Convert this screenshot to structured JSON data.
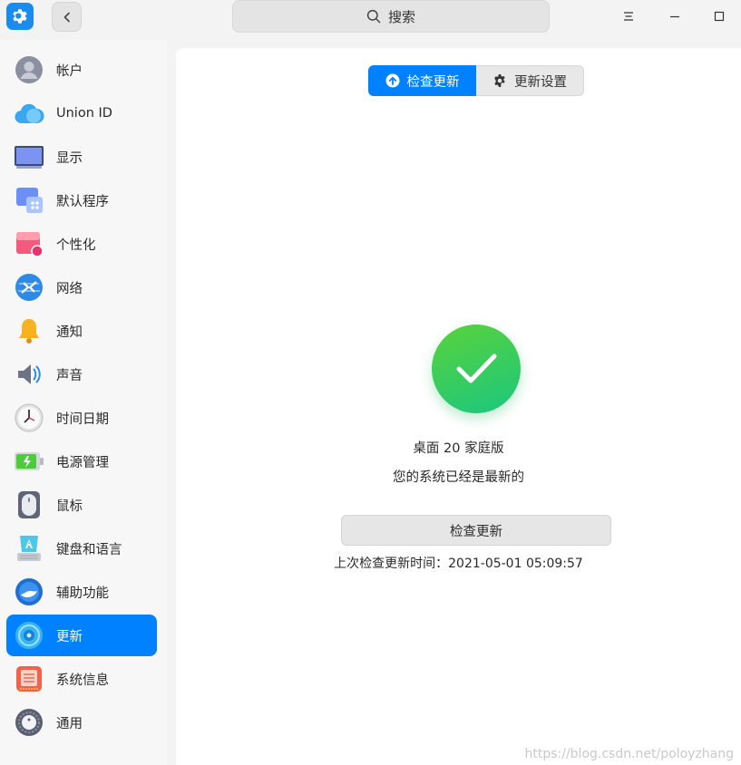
{
  "titlebar": {
    "search_label": "搜索"
  },
  "sidebar": {
    "items": [
      {
        "label": "帐户",
        "icon": "account-icon"
      },
      {
        "label": "Union ID",
        "icon": "cloud-icon"
      },
      {
        "label": "显示",
        "icon": "display-icon"
      },
      {
        "label": "默认程序",
        "icon": "default-apps-icon"
      },
      {
        "label": "个性化",
        "icon": "personalization-icon"
      },
      {
        "label": "网络",
        "icon": "network-icon"
      },
      {
        "label": "通知",
        "icon": "bell-icon"
      },
      {
        "label": "声音",
        "icon": "speaker-icon"
      },
      {
        "label": "时间日期",
        "icon": "clock-icon"
      },
      {
        "label": "电源管理",
        "icon": "battery-icon"
      },
      {
        "label": "鼠标",
        "icon": "mouse-icon"
      },
      {
        "label": "键盘和语言",
        "icon": "keyboard-icon"
      },
      {
        "label": "辅助功能",
        "icon": "accessibility-icon"
      },
      {
        "label": "更新",
        "icon": "update-icon",
        "active": true
      },
      {
        "label": "系统信息",
        "icon": "system-info-icon"
      },
      {
        "label": "通用",
        "icon": "general-icon"
      }
    ]
  },
  "main": {
    "tabs": [
      {
        "label": "检查更新",
        "active": true
      },
      {
        "label": "更新设置",
        "active": false
      }
    ],
    "version": "桌面 20 家庭版",
    "status": "您的系统已经是最新的",
    "check_button": "检查更新",
    "last_check": "上次检查更新时间：2021-05-01 05:09:57"
  },
  "watermark": "https://blog.csdn.net/poloyzhang",
  "colors": {
    "accent": "#0081ff",
    "success_start": "#59d23b",
    "success_end": "#1bc77f"
  }
}
